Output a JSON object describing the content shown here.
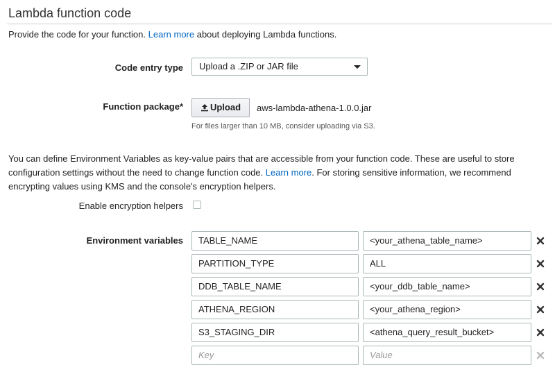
{
  "section": {
    "title": "Lambda function code",
    "intro_prefix": "Provide the code for your function. ",
    "intro_link": "Learn more",
    "intro_suffix": " about deploying Lambda functions."
  },
  "code_entry": {
    "label": "Code entry type",
    "selected": "Upload a .ZIP or JAR file"
  },
  "package": {
    "label": "Function package*",
    "upload_label": "Upload",
    "file_name": "aws-lambda-athena-1.0.0.jar",
    "hint": "For files larger than 10 MB, consider uploading via S3."
  },
  "env_info": {
    "text_1": "You can define Environment Variables as key-value pairs that are accessible from your function code. These are useful to store configuration settings without the need to change function code. ",
    "link": "Learn more",
    "text_2": ". For storing sensitive information, we recommend encrypting values using KMS and the console's encryption helpers."
  },
  "encryption": {
    "label": "Enable encryption helpers",
    "checked": false
  },
  "env_vars": {
    "label": "Environment variables",
    "rows": [
      {
        "key": "TABLE_NAME",
        "value": "<your_athena_table_name>"
      },
      {
        "key": "PARTITION_TYPE",
        "value": "ALL"
      },
      {
        "key": "DDB_TABLE_NAME",
        "value": "<your_ddb_table_name>"
      },
      {
        "key": "ATHENA_REGION",
        "value": "<your_athena_region>"
      },
      {
        "key": "S3_STAGING_DIR",
        "value": "<athena_query_result_bucket>"
      }
    ],
    "key_placeholder": "Key",
    "value_placeholder": "Value",
    "remove_icon": "close-x-icon"
  }
}
